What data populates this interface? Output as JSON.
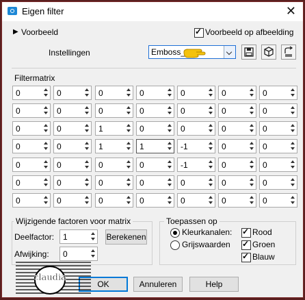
{
  "window": {
    "title": "Eigen filter"
  },
  "preview": {
    "label": "Voorbeeld",
    "on_image_label": "Voorbeeld op afbeelding",
    "on_image_checked": true
  },
  "settings": {
    "label": "Instellingen",
    "preset_value": "Emboss_3"
  },
  "matrix": {
    "label": "Filtermatrix",
    "rows": [
      [
        "0",
        "0",
        "0",
        "0",
        "0",
        "0",
        "0"
      ],
      [
        "0",
        "0",
        "0",
        "0",
        "0",
        "0",
        "0"
      ],
      [
        "0",
        "0",
        "1",
        "0",
        "0",
        "0",
        "0"
      ],
      [
        "0",
        "0",
        "1",
        "1",
        "-1",
        "0",
        "0"
      ],
      [
        "0",
        "0",
        "0",
        "0",
        "-1",
        "0",
        "0"
      ],
      [
        "0",
        "0",
        "0",
        "0",
        "0",
        "0",
        "0"
      ],
      [
        "0",
        "0",
        "0",
        "0",
        "0",
        "0",
        "0"
      ]
    ]
  },
  "factors": {
    "title": "Wijzigende factoren voor matrix",
    "divisor_label": "Deelfactor:",
    "divisor_value": "1",
    "calculate_label": "Berekenen",
    "offset_label": "Afwijking:",
    "offset_value": "0"
  },
  "apply_to": {
    "title": "Toepassen op",
    "color_channels_label": "Kleurkanalen:",
    "grayscale_label": "Grijswaarden",
    "selected": "color",
    "red_label": "Rood",
    "red_checked": true,
    "green_label": "Groen",
    "green_checked": true,
    "blue_label": "Blauw",
    "blue_checked": true
  },
  "buttons": {
    "ok": "OK",
    "cancel": "Annuleren",
    "help": "Help"
  },
  "watermark_text": "claudia"
}
